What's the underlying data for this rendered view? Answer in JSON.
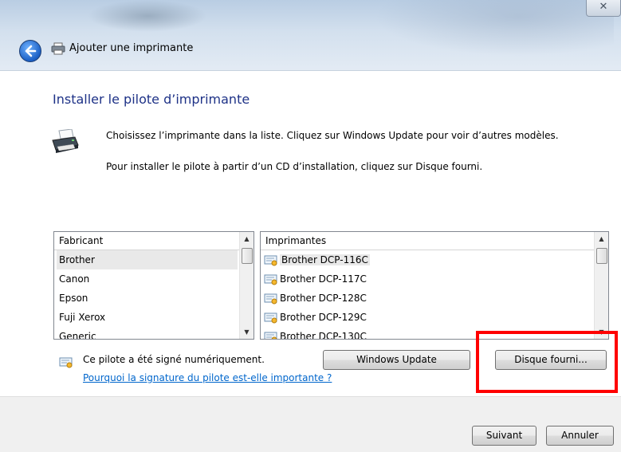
{
  "window": {
    "title": "Ajouter une imprimante",
    "close_label": "✕"
  },
  "page": {
    "heading": "Installer le pilote d’imprimante",
    "instruction_1": "Choisissez l’imprimante dans la liste. Cliquez sur Windows Update pour voir d’autres modèles.",
    "instruction_2": "Pour installer le pilote à partir d’un CD d’installation, cliquez sur Disque fourni."
  },
  "manufacturers": {
    "header": "Fabricant",
    "items": [
      "Brother",
      "Canon",
      "Epson",
      "Fuji Xerox",
      "Generic"
    ],
    "selected": "Brother"
  },
  "printers": {
    "header": "Imprimantes",
    "items": [
      "Brother DCP-116C",
      "Brother DCP-117C",
      "Brother DCP-128C",
      "Brother DCP-129C",
      "Brother DCP-130C"
    ],
    "selected": "Brother DCP-116C"
  },
  "signature": {
    "text": "Ce pilote a été signé numériquement.",
    "link": "Pourquoi la signature du pilote est-elle importante ?"
  },
  "buttons": {
    "windows_update": "Windows Update",
    "have_disk": "Disque fourni...",
    "next": "Suivant",
    "cancel": "Annuler"
  },
  "colors": {
    "heading": "#1e3287",
    "link": "#0066cc",
    "highlight": "#ff0000"
  }
}
